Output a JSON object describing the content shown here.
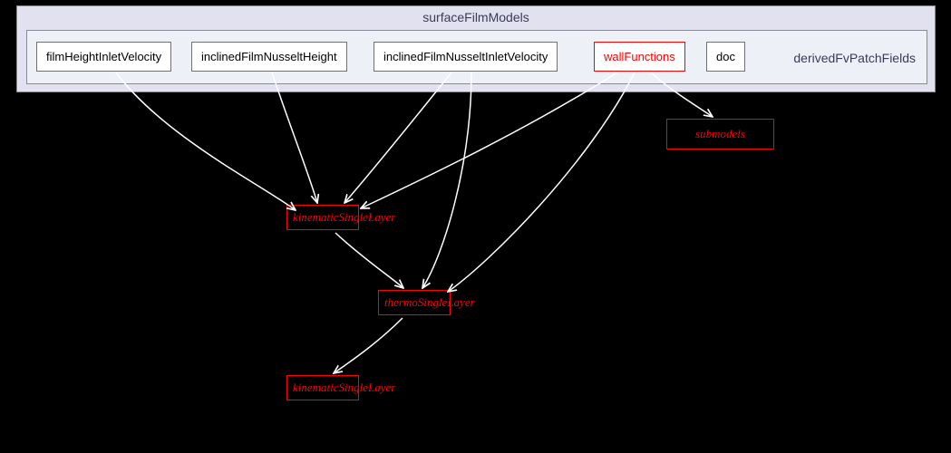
{
  "container": {
    "outer_title": "surfaceFilmModels",
    "inner_title": "derivedFvPatchFields"
  },
  "top_boxes": {
    "filmHeight": {
      "label": "filmHeightInletVelocity"
    },
    "inclinedHeight": {
      "label": "inclinedFilmNusseltHeight"
    },
    "inclinedVelocity": {
      "label": "inclinedFilmNusseltInletVelocity"
    },
    "wallFunctions": {
      "label": "wallFunctions"
    },
    "doc": {
      "label": "doc"
    }
  },
  "bottom_boxes": {
    "submodels": {
      "label": "submodels"
    },
    "kinematic_top": {
      "label": "kinematicSingleLayer"
    },
    "thermo": {
      "label": "thermoSingleLayer"
    },
    "kinematic_bottom": {
      "label": "kinematicSingleLayer"
    }
  },
  "chart_data": {
    "type": "table",
    "description": "Directory dependency graph",
    "outer_module": "surfaceFilmModels",
    "inner_module": "derivedFvPatchFields",
    "children": [
      "filmHeightInletVelocity",
      "inclinedFilmNusseltHeight",
      "inclinedFilmNusseltInletVelocity",
      "wallFunctions",
      "doc"
    ],
    "external_deps": [
      "submodels",
      "kinematicSingleLayer",
      "thermoSingleLayer",
      "kinematicSingleLayer"
    ],
    "edges": [
      {
        "from": "filmHeightInletVelocity",
        "to": "kinematicSingleLayer"
      },
      {
        "from": "inclinedFilmNusseltHeight",
        "to": "kinematicSingleLayer"
      },
      {
        "from": "inclinedFilmNusseltInletVelocity",
        "to": "kinematicSingleLayer"
      },
      {
        "from": "inclinedFilmNusseltInletVelocity",
        "to": "thermoSingleLayer"
      },
      {
        "from": "wallFunctions",
        "to": "kinematicSingleLayer"
      },
      {
        "from": "wallFunctions",
        "to": "thermoSingleLayer"
      },
      {
        "from": "wallFunctions",
        "to": "submodels"
      },
      {
        "from": "kinematicSingleLayer_top",
        "to": "thermoSingleLayer"
      },
      {
        "from": "thermoSingleLayer",
        "to": "kinematicSingleLayer_bottom"
      }
    ]
  }
}
